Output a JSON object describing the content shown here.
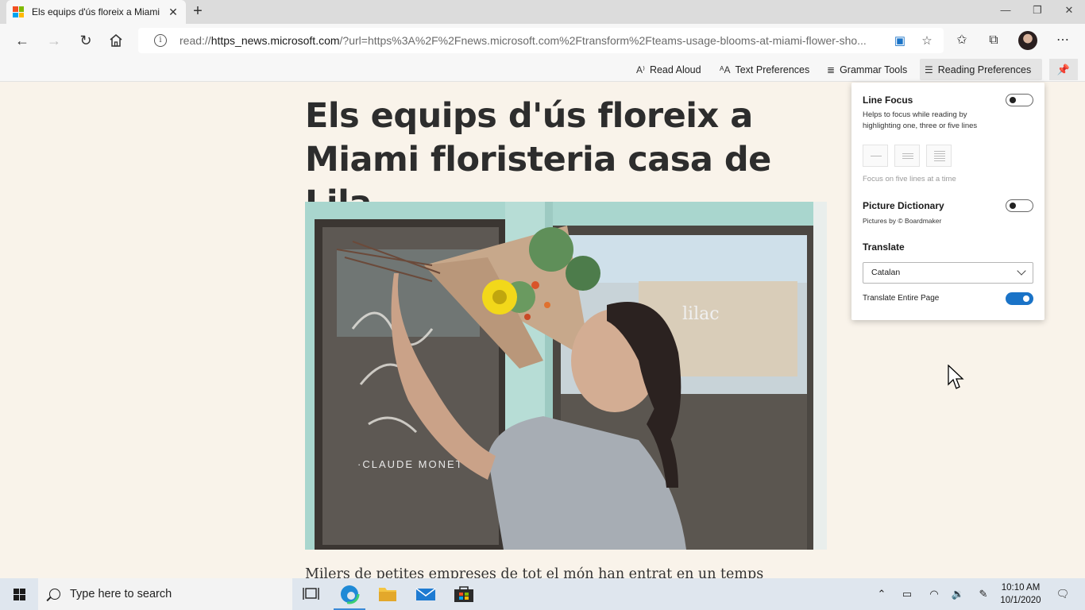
{
  "browser": {
    "tab_title": "Els equips d'ús floreix a Miami",
    "new_tab_symbol": "+",
    "url_prefix": "read://",
    "url_host": "https_news.microsoft.com",
    "url_rest": "/?url=https%3A%2F%2Fnews.microsoft.com%2Ftransform%2Fteams-usage-blooms-at-miami-flower-sho..."
  },
  "reader_toolbar": {
    "read_aloud": "Read Aloud",
    "text_preferences": "Text Preferences",
    "grammar_tools": "Grammar Tools",
    "reading_preferences": "Reading Preferences"
  },
  "article": {
    "headline": "Els equips d'ús floreix a Miami floristeria casa de Lila",
    "body_start": "Milers de petites empreses de tot el món han entrat en un temps",
    "photo_storefront_text": "lilac",
    "photo_window_text": "·CLAUDE MONET·"
  },
  "panel": {
    "line_focus": {
      "title": "Line Focus",
      "description": "Helps to focus while reading by highlighting one, three or five lines",
      "enabled": false,
      "note": "Focus on five lines at a time"
    },
    "picture_dictionary": {
      "title": "Picture Dictionary",
      "credit": "Pictures by © Boardmaker",
      "enabled": false
    },
    "translate": {
      "title": "Translate",
      "selected_language": "Catalan",
      "translate_entire_page_label": "Translate Entire Page",
      "translate_entire_page": true
    }
  },
  "taskbar": {
    "search_placeholder": "Type here to search",
    "time": "10:10 AM",
    "date": "10/1/2020"
  },
  "colors": {
    "page_background": "#f9f3ea",
    "accent": "#1a73c7"
  }
}
